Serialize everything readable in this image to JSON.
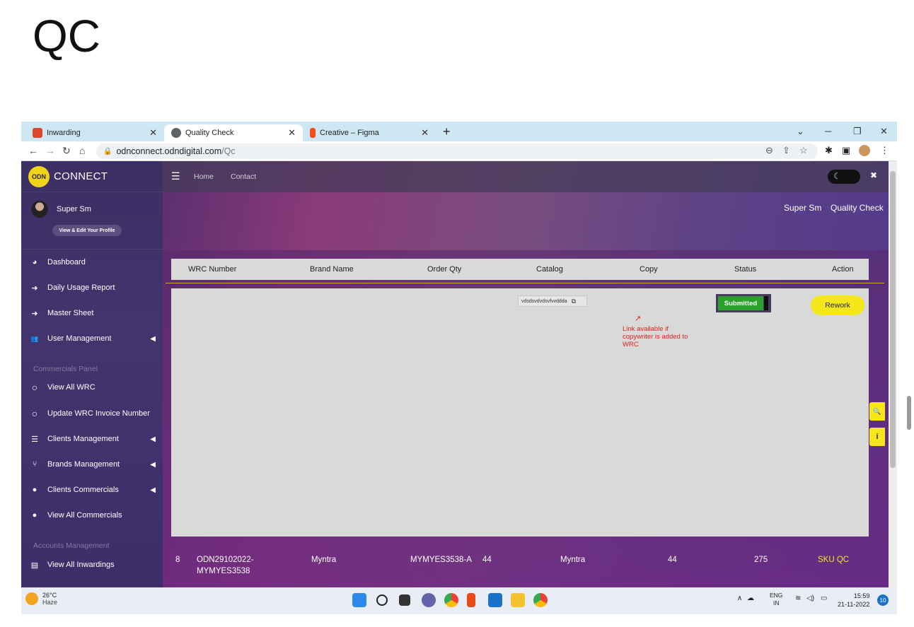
{
  "slide": {
    "title": "QC"
  },
  "browser": {
    "tabs": [
      {
        "label": "Inwarding",
        "favicon_color": "#d94a2a"
      },
      {
        "label": "Quality Check",
        "favicon_color": "#5f6368"
      },
      {
        "label": "Creative – Figma",
        "favicon_color": "#f24e1e"
      }
    ],
    "url_host": "odnconnect.odndigital.com",
    "url_path": "/Qc"
  },
  "sidebar": {
    "logo_text": "ODN",
    "brand_name": "CONNECT",
    "user_name": "Super Sm",
    "profile_button": "View & Edit Your Profile",
    "items": [
      {
        "label": "Dashboard",
        "icon": "palette-icon",
        "glyph": "◕"
      },
      {
        "label": "Daily Usage Report",
        "icon": "sign-in-icon",
        "glyph": "➜"
      },
      {
        "label": "Master Sheet",
        "icon": "sign-in-icon",
        "glyph": "➜"
      },
      {
        "label": "User Management",
        "icon": "users-icon",
        "glyph": "👥"
      },
      {
        "label": "View All WRC",
        "icon": "circle-icon",
        "glyph": "○"
      },
      {
        "label": "Update WRC Invoice Number",
        "icon": "circle-icon",
        "glyph": "○"
      },
      {
        "label": "Clients Management",
        "icon": "list-check-icon",
        "glyph": "☰"
      },
      {
        "label": "Brands Management",
        "icon": "branch-icon",
        "glyph": "⑂"
      },
      {
        "label": "Clients Commercials",
        "icon": "user-icon",
        "glyph": "●"
      },
      {
        "label": "View All Commercials",
        "icon": "user-icon",
        "glyph": "●"
      },
      {
        "label": "View All Inwardings",
        "icon": "file-icon",
        "glyph": "▤"
      }
    ],
    "section_commercials": "Commercials Panel",
    "section_accounts": "Accounts Management"
  },
  "topnav": {
    "home": "Home",
    "contact": "Contact"
  },
  "breadcrumb": {
    "user": "Super Sm",
    "page": "Quality Check"
  },
  "table": {
    "headers": [
      "WRC Number",
      "Brand Name",
      "Order Qty",
      "Catalog",
      "Copy",
      "Status",
      "Action"
    ],
    "copy_link_text": "vdsdsvdvdsvfvvddda",
    "annotation": "Link available if copywriter is added to WRC",
    "status": "Submitted",
    "action": "Rework",
    "row": {
      "index": "8",
      "wrc": "ODN29102022-MYMYES3538",
      "brand": "Myntra",
      "code": "MYMYES3538-A",
      "qty": "44",
      "catalog": "Myntra",
      "copy": "44",
      "status": "275",
      "action": "SKU QC"
    }
  },
  "side_buttons": {
    "search": "🔍",
    "info": "i"
  },
  "taskbar": {
    "temp": "26°C",
    "weather": "Haze",
    "lang_top": "ENG",
    "lang_bottom": "IN",
    "time": "15:59",
    "date": "21-11-2022",
    "notifications": "10"
  },
  "colors": {
    "accent_yellow": "#f5e71a",
    "status_green": "#2aa12a",
    "annotation_red": "#e02020",
    "sidebar_bg": "#3b2f63"
  }
}
